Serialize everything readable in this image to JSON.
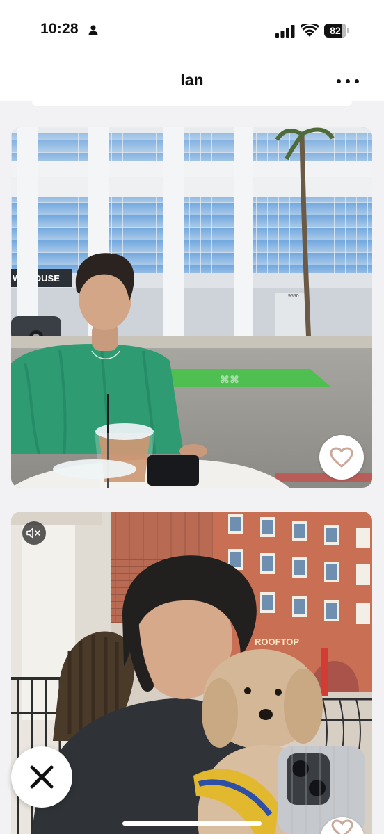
{
  "status_bar": {
    "time": "10:28",
    "battery_level": "82",
    "battery_fraction": 0.82,
    "icons": [
      "person-icon",
      "cellular-signal-icon",
      "wifi-icon",
      "battery-icon"
    ]
  },
  "header": {
    "title": "Ian",
    "menu_icon": "more-horizontal-icon"
  },
  "cards": [
    {
      "type": "photo",
      "sign_text": "WNHOUSE",
      "address_text": "9550",
      "action_icon": "heart-icon"
    },
    {
      "type": "video",
      "sign_text": "ROOFTOP",
      "audio_icon": "speaker-muted-icon",
      "action_icon": "heart-icon"
    }
  ],
  "actions": {
    "skip_icon": "close-x-icon",
    "like_icon": "heart-icon"
  },
  "colors": {
    "accent": "#c9a99a",
    "background": "#f2f2f4",
    "text": "#111111"
  }
}
